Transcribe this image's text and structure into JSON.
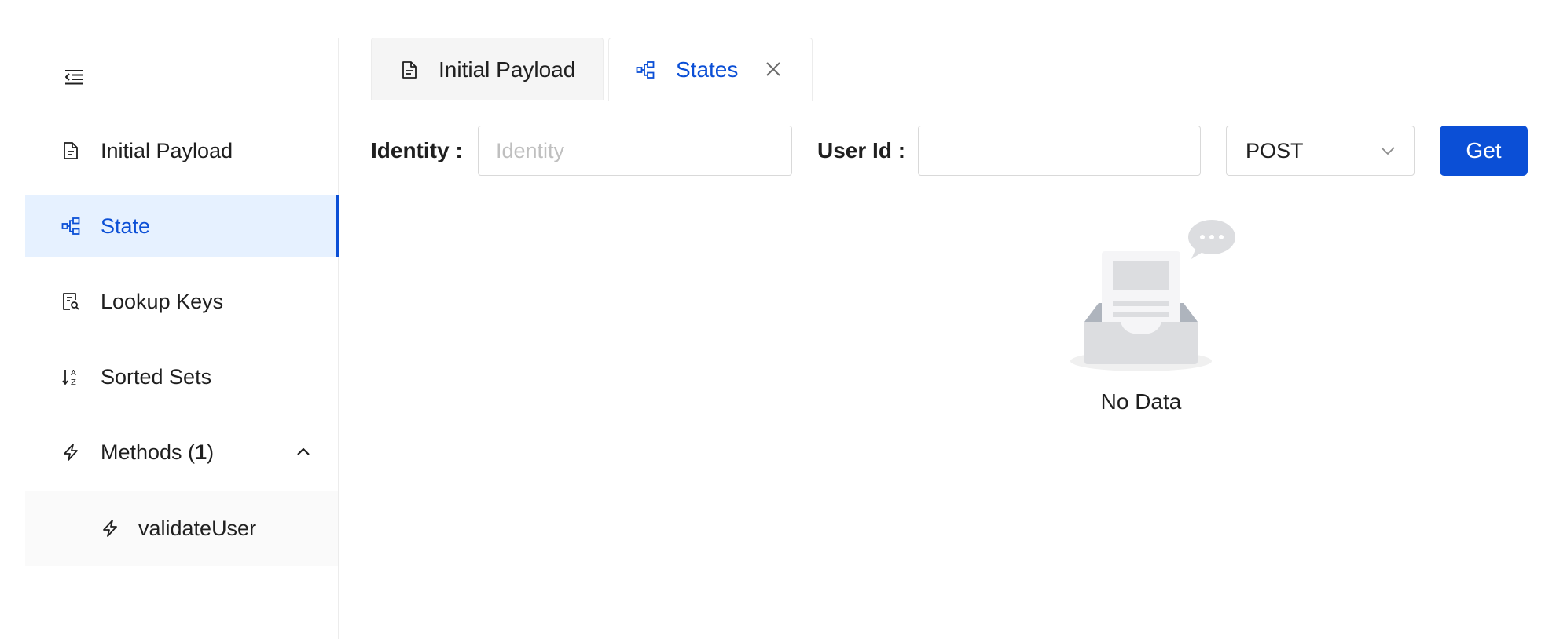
{
  "sidebar": {
    "collapse_icon": "menu-fold-icon",
    "items": [
      {
        "label": "Initial Payload",
        "icon": "file-text-icon",
        "active": false
      },
      {
        "label": "State",
        "icon": "partition-icon",
        "active": true
      },
      {
        "label": "Lookup Keys",
        "icon": "file-search-icon",
        "active": false
      },
      {
        "label": "Sorted Sets",
        "icon": "sort-ascending-icon",
        "active": false
      }
    ],
    "methods": {
      "label_prefix": "Methods (",
      "count": "1",
      "label_suffix": ")",
      "icon": "thunderbolt-icon",
      "expanded": true,
      "children": [
        {
          "label": "validateUser",
          "icon": "thunderbolt-icon"
        }
      ]
    }
  },
  "tabs": [
    {
      "label": "Initial Payload",
      "icon": "file-text-icon",
      "active": false,
      "closable": false
    },
    {
      "label": "States",
      "icon": "partition-icon",
      "active": true,
      "closable": true
    }
  ],
  "form": {
    "identity_label": "Identity",
    "identity_placeholder": "Identity",
    "identity_value": "",
    "userid_label": "User Id",
    "userid_value": "",
    "method_select": {
      "value": "POST"
    },
    "submit_label": "Get"
  },
  "empty": {
    "text": "No Data"
  },
  "colors": {
    "primary": "#0b4fd6",
    "active_bg": "#e6f1ff",
    "border": "#d9d9d9"
  }
}
